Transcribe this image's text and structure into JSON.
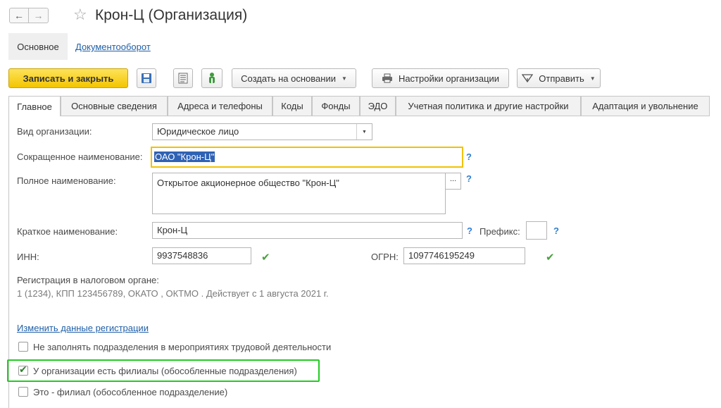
{
  "window": {
    "back_icon": "←",
    "forward_icon": "→",
    "star_icon": "☆",
    "title": "Крон-Ц (Организация)"
  },
  "nav": {
    "main": "Основное",
    "docflow": "Документооборот"
  },
  "toolbar": {
    "save_close": "Записать и закрыть",
    "create_based": "Создать на основании",
    "org_settings": "Настройки организации",
    "send": "Отправить"
  },
  "tabs": [
    {
      "label": "Главное"
    },
    {
      "label": "Основные сведения"
    },
    {
      "label": "Адреса и телефоны"
    },
    {
      "label": "Коды"
    },
    {
      "label": "Фонды"
    },
    {
      "label": "ЭДО"
    },
    {
      "label": "Учетная политика и другие настройки"
    },
    {
      "label": "Адаптация и увольнение"
    }
  ],
  "form": {
    "org_type_label": "Вид организации:",
    "org_type_value": "Юридическое лицо",
    "short_name_label": "Сокращенное наименование:",
    "short_name_value": "ОАО \"Крон-Ц\"",
    "full_name_label": "Полное наименование:",
    "full_name_value": "Открытое акционерное общество \"Крон-Ц\"",
    "brief_name_label": "Краткое наименование:",
    "brief_name_value": "Крон-Ц",
    "prefix_label": "Префикс:",
    "prefix_value": "",
    "inn_label": "ИНН:",
    "inn_value": "9937548836",
    "ogrn_label": "ОГРН:",
    "ogrn_value": "1097746195249",
    "tax_reg_label": "Регистрация в налоговом органе:",
    "tax_reg_value": "1 (1234), КПП 123456789, ОКАТО , ОКТМО . Действует с 1 августа 2021 г.",
    "change_reg_link": "Изменить данные регистрации",
    "help_mark": "?",
    "ellipsis": "...",
    "valid_mark": "✔"
  },
  "checkboxes": {
    "no_fill_label": "Не заполнять подразделения в мероприятиях трудовой деятельности",
    "no_fill_checked": false,
    "has_branches_label": "У организации есть филиалы (обособленные подразделения)",
    "has_branches_checked": true,
    "is_branch_label": "Это - филиал (обособленное подразделение)",
    "is_branch_checked": false,
    "check_glyph": "✔"
  },
  "colors": {
    "primary_button": "#f3c500",
    "highlight": "#22cc22",
    "link": "#1f5fa8",
    "help": "#2f7fcf"
  }
}
